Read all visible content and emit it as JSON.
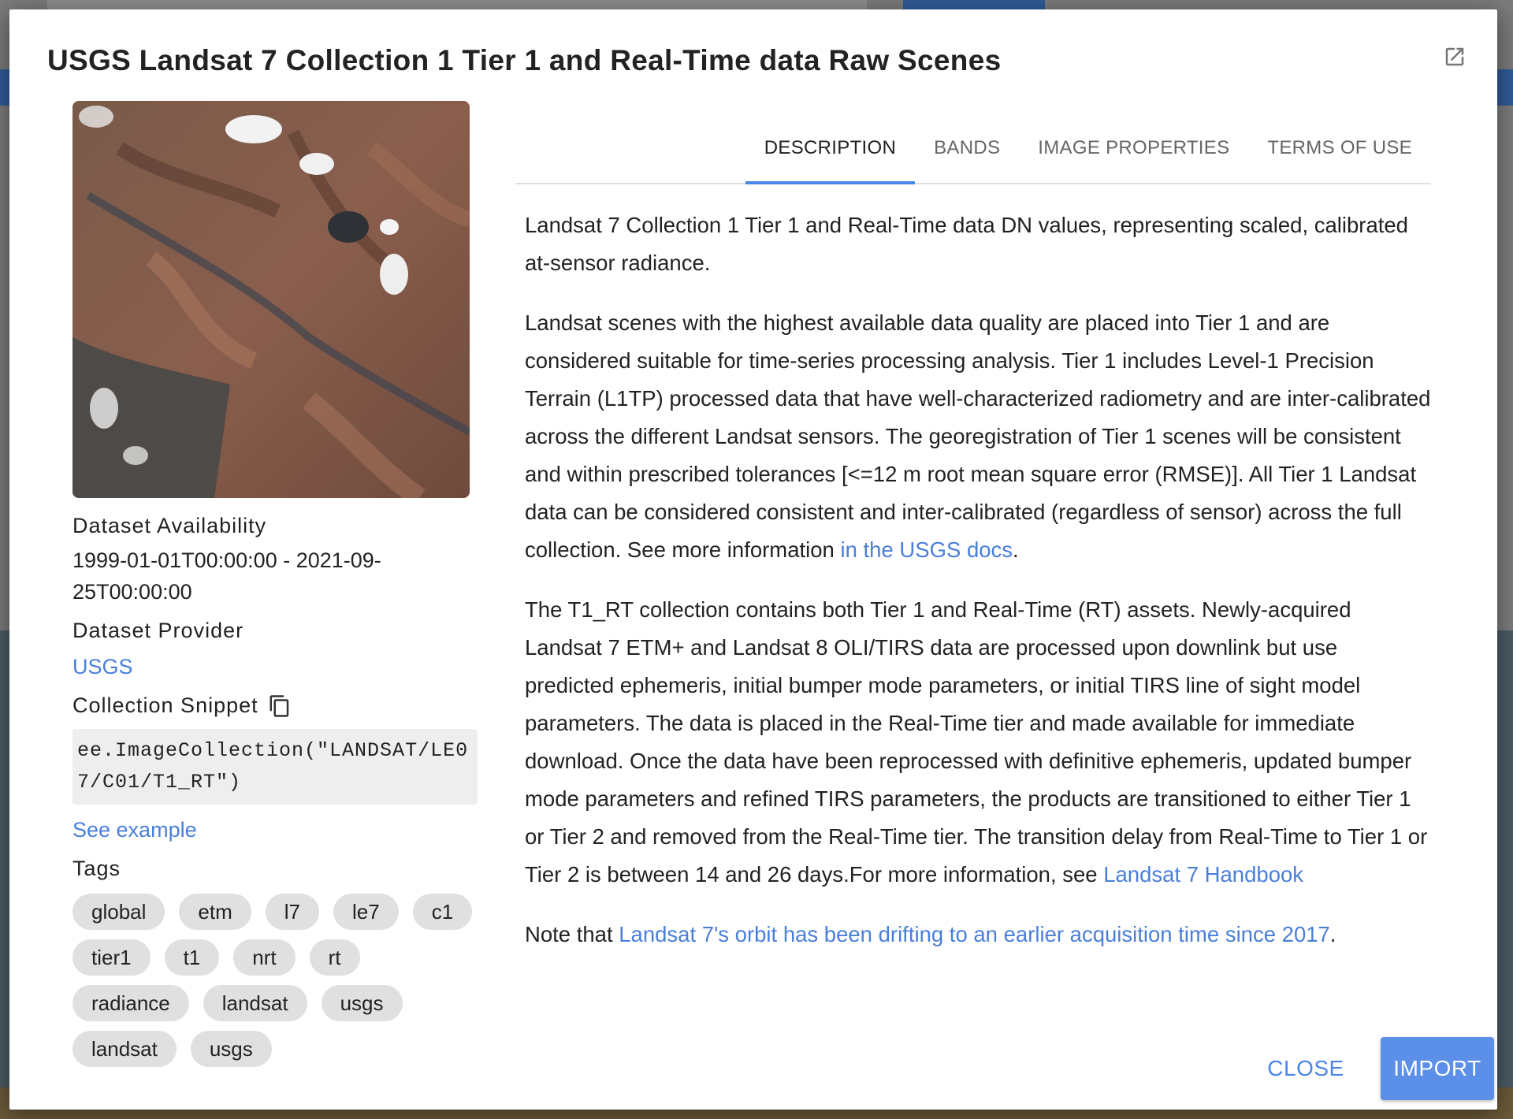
{
  "dialog": {
    "title": "USGS Landsat 7 Collection 1 Tier 1 and Real-Time data Raw Scenes",
    "open_external_icon": "open-in-new-icon"
  },
  "sidebar": {
    "availability_label": "Dataset Availability",
    "availability_value": "1999-01-01T00:00:00 - 2021-09-25T00:00:00",
    "provider_label": "Dataset Provider",
    "provider_value": "USGS",
    "snippet_label": "Collection Snippet",
    "copy_icon": "copy-icon",
    "snippet_value": "ee.ImageCollection(\"LANDSAT/LE07/C01/T1_RT\")",
    "see_example": "See example",
    "tags_label": "Tags",
    "tags": [
      "global",
      "etm",
      "l7",
      "le7",
      "c1",
      "tier1",
      "t1",
      "nrt",
      "rt",
      "radiance",
      "landsat",
      "usgs",
      "landsat",
      "usgs"
    ]
  },
  "tabs": [
    {
      "label": "DESCRIPTION",
      "active": true
    },
    {
      "label": "BANDS",
      "active": false
    },
    {
      "label": "IMAGE PROPERTIES",
      "active": false
    },
    {
      "label": "TERMS OF USE",
      "active": false
    }
  ],
  "description": {
    "p1": "Landsat 7 Collection 1 Tier 1 and Real-Time data DN values, representing scaled, calibrated at-sensor radiance.",
    "p2_text": "Landsat scenes with the highest available data quality are placed into Tier 1 and are considered suitable for time-series processing analysis. Tier 1 includes Level-1 Precision Terrain (L1TP) processed data that have well-characterized radiometry and are inter-calibrated across the different Landsat sensors. The georegistration of Tier 1 scenes will be consistent and within prescribed tolerances [<=12 m root mean square error (RMSE)]. All Tier 1 Landsat data can be considered consistent and inter-calibrated (regardless of sensor) across the full collection. See more information ",
    "p2_link": "in the USGS docs",
    "p2_end": ".",
    "p3_text": "The T1_RT collection contains both Tier 1 and Real-Time (RT) assets. Newly-acquired Landsat 7 ETM+ and Landsat 8 OLI/TIRS data are processed upon downlink but use predicted ephemeris, initial bumper mode parameters, or initial TIRS line of sight model parameters. The data is placed in the Real-Time tier and made available for immediate download. Once the data have been reprocessed with definitive ephemeris, updated bumper mode parameters and refined TIRS parameters, the products are transitioned to either Tier 1 or Tier 2 and removed from the Real-Time tier. The transition delay from Real-Time to Tier 1 or Tier 2 is between 14 and 26 days.For more information, see ",
    "p3_link": "Landsat 7 Handbook",
    "p4_text": "Note that ",
    "p4_link": "Landsat 7's orbit has been drifting to an earlier acquisition time since 2017",
    "p4_end": "."
  },
  "footer": {
    "close_label": "CLOSE",
    "import_label": "IMPORT"
  },
  "colors": {
    "accent": "#4a86e8",
    "link": "#4a7fd9",
    "import_button": "#5b8fe8"
  }
}
